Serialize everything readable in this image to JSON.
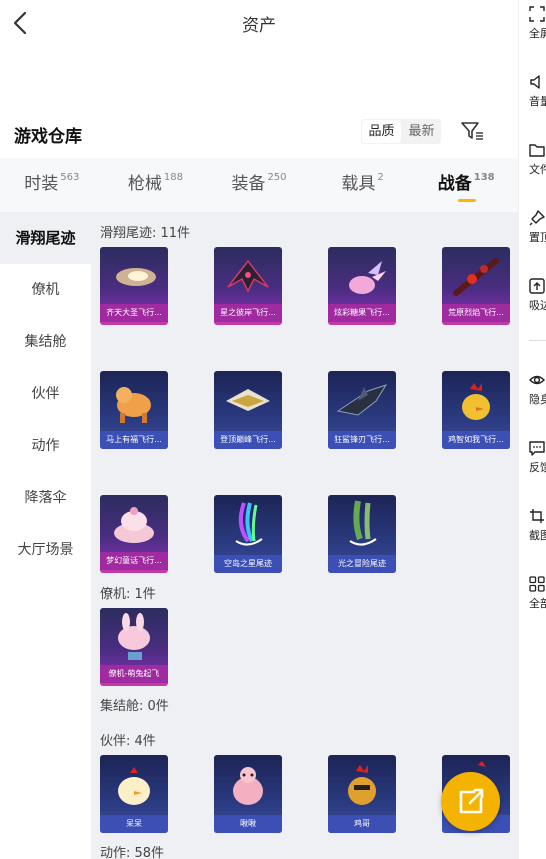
{
  "header": {
    "title": "资产"
  },
  "warehouse": {
    "title": "游戏仓库",
    "sort_options": [
      "品质",
      "最新"
    ]
  },
  "tabs": [
    {
      "label": "时装",
      "count": "563"
    },
    {
      "label": "枪械",
      "count": "188"
    },
    {
      "label": "装备",
      "count": "250"
    },
    {
      "label": "载具",
      "count": "2"
    },
    {
      "label": "战备",
      "count": "138"
    }
  ],
  "left_nav": [
    "滑翔尾迹",
    "僚机",
    "集结舱",
    "伙伴",
    "动作",
    "降落伞",
    "大厅场景"
  ],
  "sections": {
    "glide": {
      "label": "滑翔尾迹: 11件"
    },
    "wing": {
      "label": "僚机: 1件"
    },
    "pod": {
      "label": "集结舱: 0件"
    },
    "partner": {
      "label": "伙伴: 4件"
    },
    "action": {
      "label": "动作: 58件"
    }
  },
  "items": {
    "glide": [
      "齐天大圣飞行...",
      "星之彼岸飞行...",
      "炫彩糖果飞行...",
      "荒原烈焰飞行...",
      "马上有福飞行...",
      "登顶巅峰飞行...",
      "狂鲨锋刃飞行...",
      "鸡智如我飞行...",
      "梦幻童话飞行...",
      "空岛之星尾迹",
      "光之冒险尾迹"
    ],
    "wing": [
      "僚机-萌兔起飞"
    ],
    "partner": [
      "呆呆",
      "啾啾",
      "鸡哥",
      ""
    ]
  },
  "right_panel": [
    {
      "label": "全屏",
      "icon": "fullscreen-icon"
    },
    {
      "label": "音量",
      "icon": "speaker-icon"
    },
    {
      "label": "文件",
      "icon": "folder-icon"
    },
    {
      "label": "置顶",
      "icon": "pin-icon"
    },
    {
      "label": "吸边",
      "icon": "dock-icon"
    },
    {
      "label": "隐身",
      "icon": "eye-icon"
    },
    {
      "label": "反馈",
      "icon": "feedback-icon"
    },
    {
      "label": "截图",
      "icon": "crop-icon"
    },
    {
      "label": "全部",
      "icon": "grid-icon"
    }
  ],
  "colors": {
    "accent": "#ffb400",
    "fab": "#f5b301",
    "rare_purple": "#a02aa0",
    "rare_blue": "#3b4fb4"
  }
}
